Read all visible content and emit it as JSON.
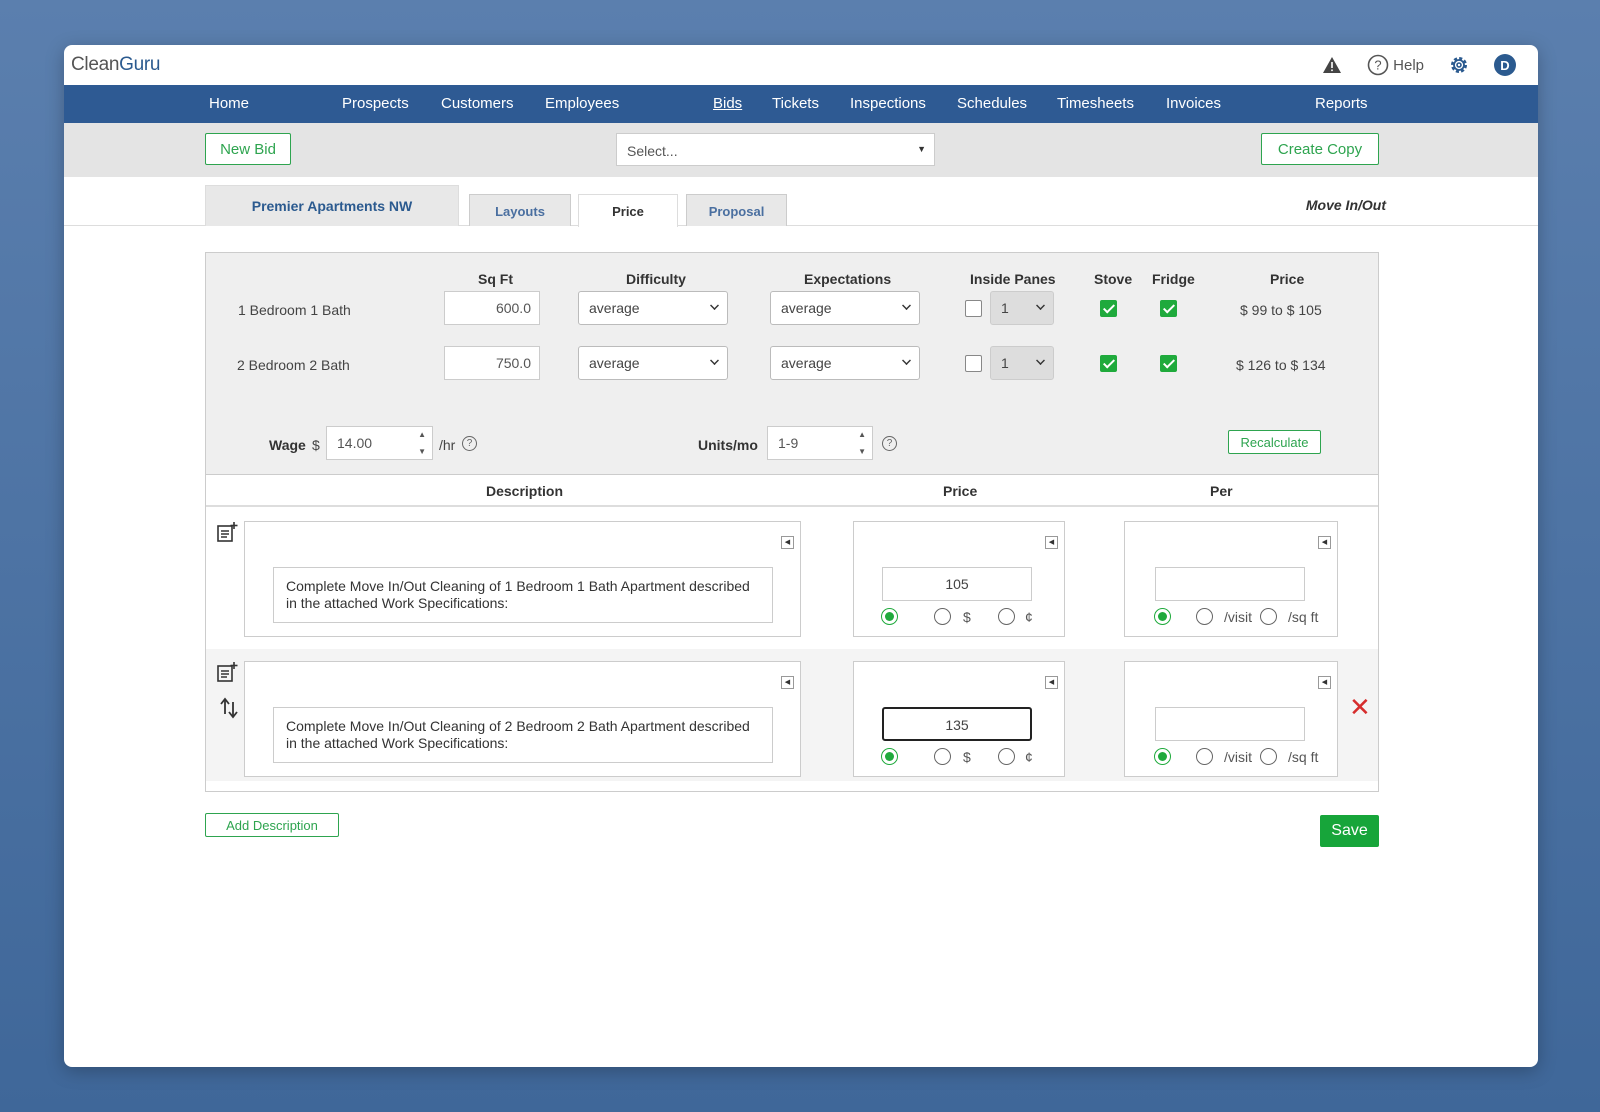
{
  "app": {
    "logo_plain": "Clean",
    "logo_bold": "Guru"
  },
  "topbar": {
    "help_label": "Help",
    "avatar_initial": "D"
  },
  "nav": {
    "home": "Home",
    "prospects": "Prospects",
    "customers": "Customers",
    "employees": "Employees",
    "bids": "Bids",
    "tickets": "Tickets",
    "inspections": "Inspections",
    "schedules": "Schedules",
    "timesheets": "Timesheets",
    "invoices": "Invoices",
    "reports": "Reports"
  },
  "toolbar": {
    "new_bid": "New Bid",
    "select_placeholder": "Select...",
    "create_copy": "Create Copy"
  },
  "tabs": {
    "account": "Premier Apartments NW",
    "layouts": "Layouts",
    "price": "Price",
    "proposal": "Proposal",
    "service_type": "Move In/Out"
  },
  "calc": {
    "headers": {
      "sqft": "Sq Ft",
      "difficulty": "Difficulty",
      "expectations": "Expectations",
      "inside_panes": "Inside Panes",
      "stove": "Stove",
      "fridge": "Fridge",
      "price": "Price"
    },
    "rows": [
      {
        "label": "1 Bedroom 1 Bath",
        "sqft": "600.0",
        "difficulty": "average",
        "expectations": "average",
        "inside_panes_checked": false,
        "panes": "1",
        "stove": true,
        "fridge": true,
        "price": "$ 99 to $ 105"
      },
      {
        "label": "2 Bedroom 2 Bath",
        "sqft": "750.0",
        "difficulty": "average",
        "expectations": "average",
        "inside_panes_checked": false,
        "panes": "1",
        "stove": true,
        "fridge": true,
        "price": "$ 126 to $ 134"
      }
    ],
    "wage_label": "Wage",
    "wage_currency": "$",
    "wage_value": "14.00",
    "wage_unit": "/hr",
    "units_label": "Units/mo",
    "units_value": "1-9",
    "recalculate": "Recalculate"
  },
  "lines": {
    "headers": {
      "description": "Description",
      "price": "Price",
      "per": "Per"
    },
    "items": [
      {
        "description": "Complete Move In/Out Cleaning of 1 Bedroom 1 Bath Apartment described in the attached Work Specifications:",
        "price": "105",
        "per": "",
        "dollar": "$",
        "cent": "¢",
        "visit": "/visit",
        "sqft": "/sq ft"
      },
      {
        "description": "Complete Move In/Out Cleaning of 2 Bedroom 2 Bath Apartment described in the attached Work Specifications:",
        "price": "135",
        "per": "",
        "dollar": "$",
        "cent": "¢",
        "visit": "/visit",
        "sqft": "/sq ft"
      }
    ]
  },
  "actions": {
    "add_description": "Add Description",
    "save": "Save"
  },
  "colors": {
    "nav_blue": "#2e5a93",
    "green": "#1faa3c",
    "delete_red": "#d62d2d"
  }
}
